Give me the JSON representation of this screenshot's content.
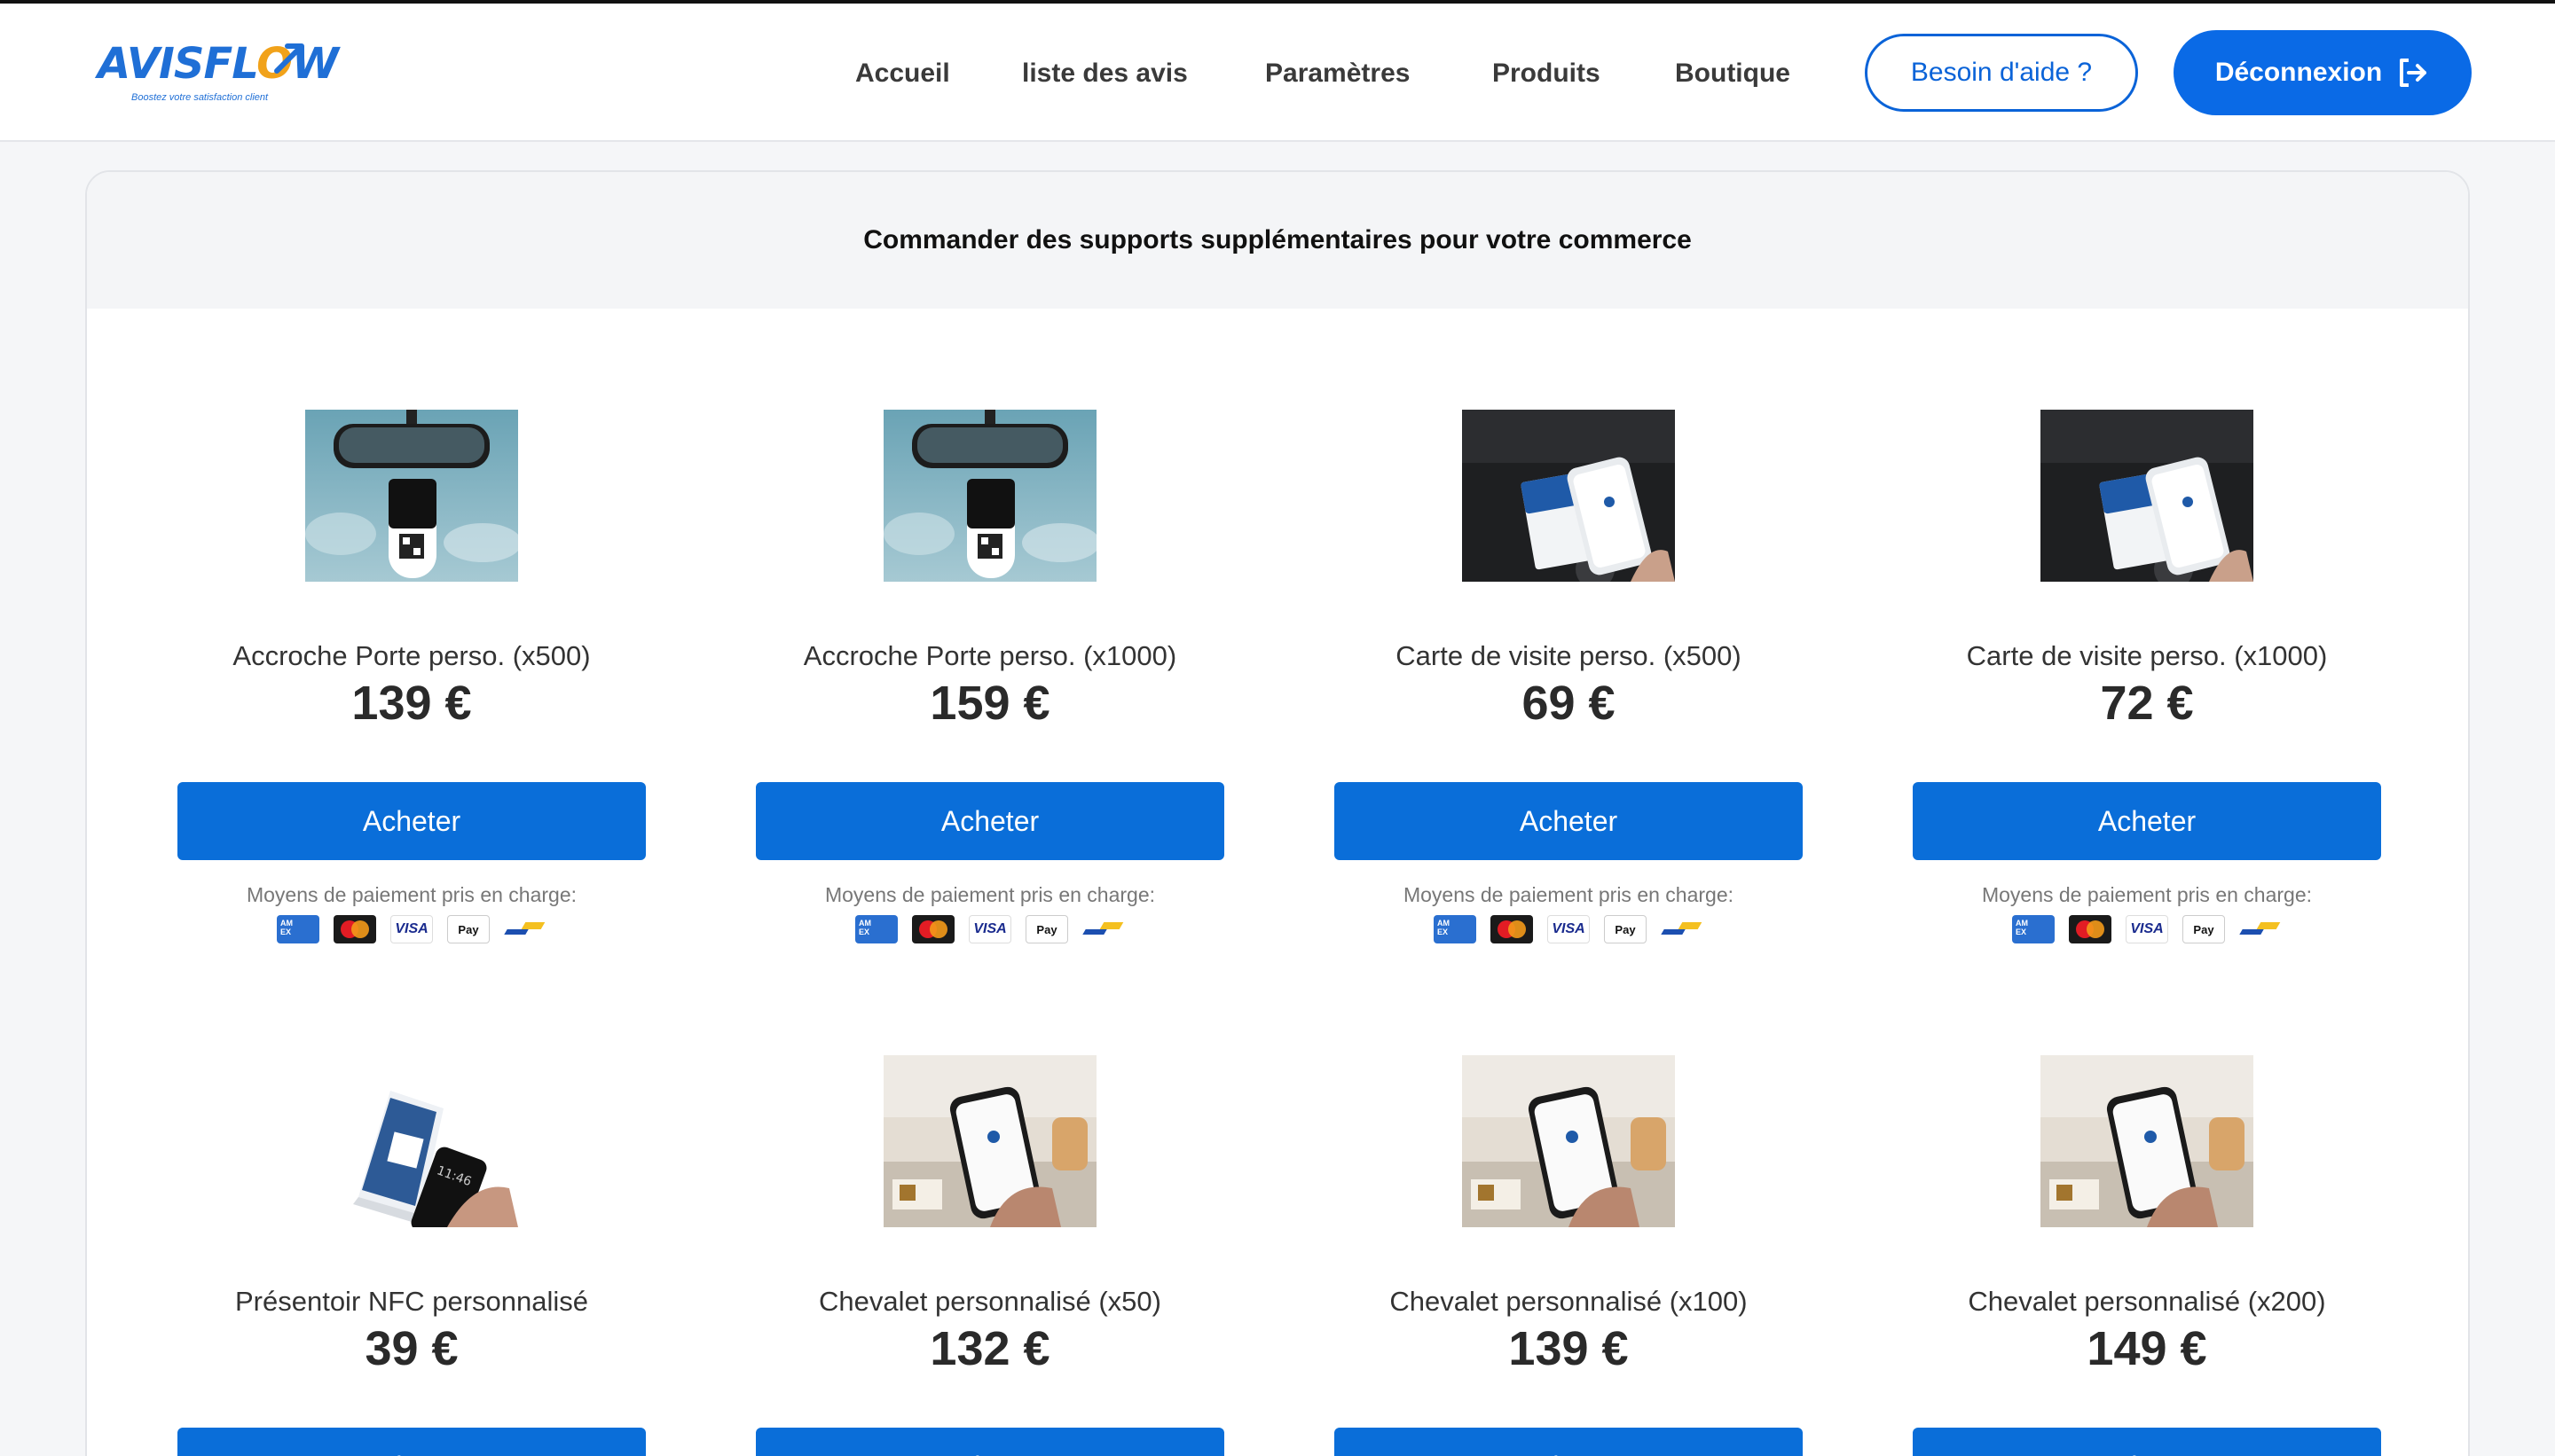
{
  "header": {
    "logo_text": "AVISFLOW",
    "logo_tagline": "Boostez votre satisfaction client",
    "nav": [
      {
        "label": "Accueil"
      },
      {
        "label": "liste des avis"
      },
      {
        "label": "Paramètres"
      },
      {
        "label": "Produits"
      },
      {
        "label": "Boutique"
      }
    ],
    "help_button": "Besoin d'aide ?",
    "logout_button": "Déconnexion",
    "accent_color": "#0a6ae6"
  },
  "shop": {
    "title": "Commander des supports supplémentaires pour votre commerce",
    "buy_label": "Acheter",
    "payment_label": "Moyens de paiement pris en charge:",
    "payment_methods": [
      "amex-icon",
      "mastercard-icon",
      "visa-icon",
      "apple-pay-icon",
      "carte-bancaire-icon"
    ],
    "products": [
      {
        "name": "Accroche Porte perso. (x500)",
        "price": "139 €",
        "image": "car-mirror-hanger"
      },
      {
        "name": "Accroche Porte perso. (x1000)",
        "price": "159 €",
        "image": "car-mirror-hanger"
      },
      {
        "name": "Carte de visite perso. (x500)",
        "price": "69 €",
        "image": "business-card-phone"
      },
      {
        "name": "Carte de visite perso. (x1000)",
        "price": "72 €",
        "image": "business-card-phone"
      },
      {
        "name": "Présentoir NFC personnalisé",
        "price": "39 €",
        "image": "nfc-display"
      },
      {
        "name": "Chevalet personnalisé (x50)",
        "price": "132 €",
        "image": "counter-stand-phone"
      },
      {
        "name": "Chevalet personnalisé (x100)",
        "price": "139 €",
        "image": "counter-stand-phone"
      },
      {
        "name": "Chevalet personnalisé (x200)",
        "price": "149 €",
        "image": "counter-stand-phone"
      }
    ]
  }
}
